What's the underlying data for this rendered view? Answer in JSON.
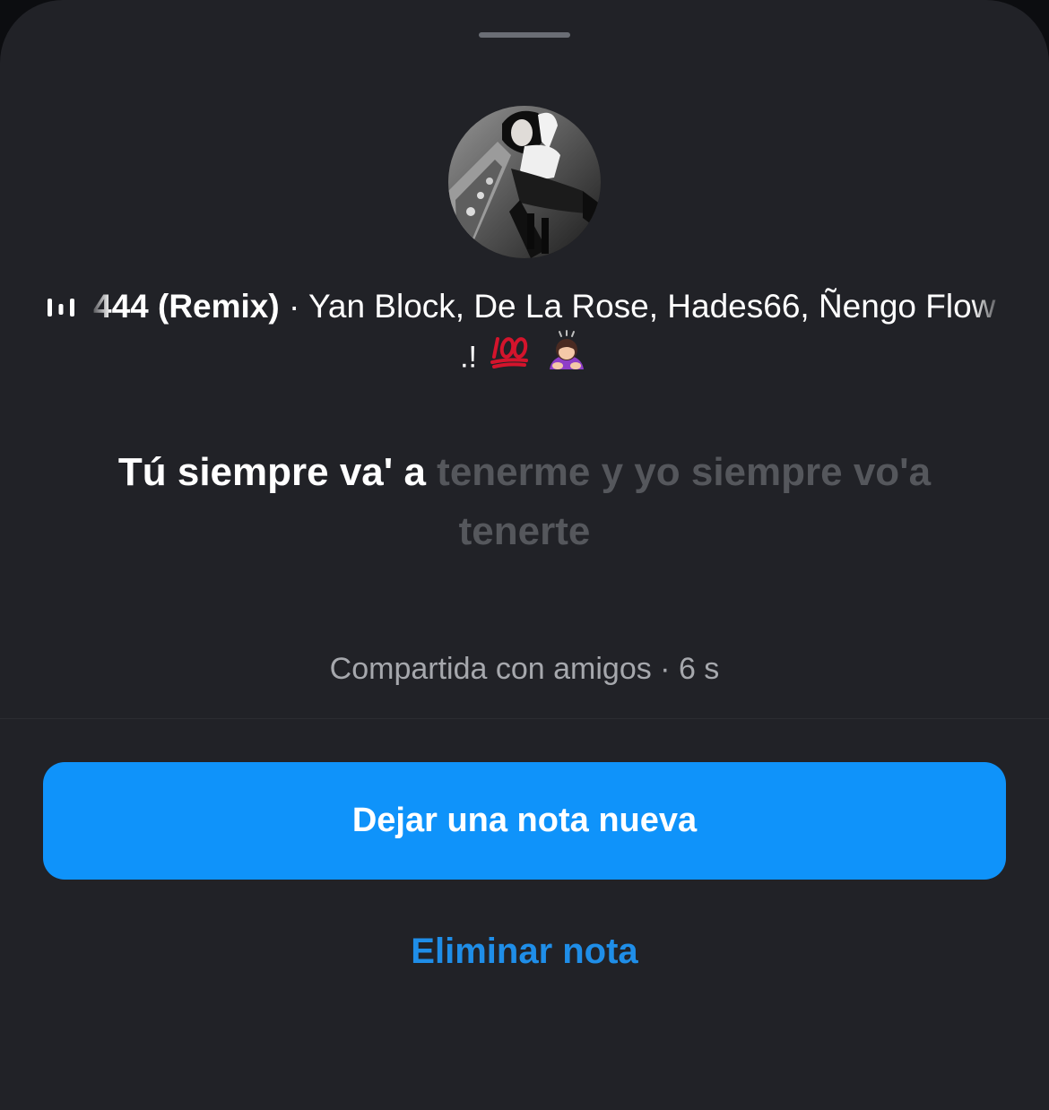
{
  "note": {
    "music": {
      "track_title": "444 (Remix)",
      "separator": " · ",
      "artists": "Yan Block, De La Rose, Hades66, Ñengo Flow"
    },
    "emoji_caption": ".!",
    "emoji_icons": [
      "hundred-points-icon",
      "person-bowing-icon"
    ],
    "lyric": {
      "sung": "Tú siempre va' a ",
      "unsung": "tenerme y yo siempre vo'a tenerte"
    },
    "meta": "Compartida con amigos · 6 s"
  },
  "actions": {
    "primary_label": "Dejar una nota nueva",
    "secondary_label": "Eliminar nota"
  },
  "colors": {
    "sheet_background": "#212227",
    "primary_button": "#0f93fa",
    "link": "#1f8ee8",
    "muted_text": "#a6a8ad",
    "unsung_lyric": "#55575c"
  }
}
